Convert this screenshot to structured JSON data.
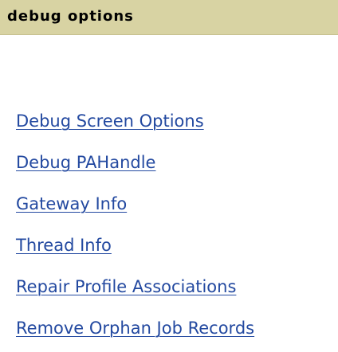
{
  "header": {
    "title": "debug options"
  },
  "links": [
    {
      "label": "Debug Screen Options"
    },
    {
      "label": "Debug PAHandle"
    },
    {
      "label": "Gateway Info"
    },
    {
      "label": "Thread Info"
    },
    {
      "label": "Repair Profile Associations"
    },
    {
      "label": "Remove Orphan Job Records"
    }
  ],
  "colors": {
    "header_bg": "#d8d3a3",
    "link": "#2349a0",
    "background": "#ffffff"
  }
}
